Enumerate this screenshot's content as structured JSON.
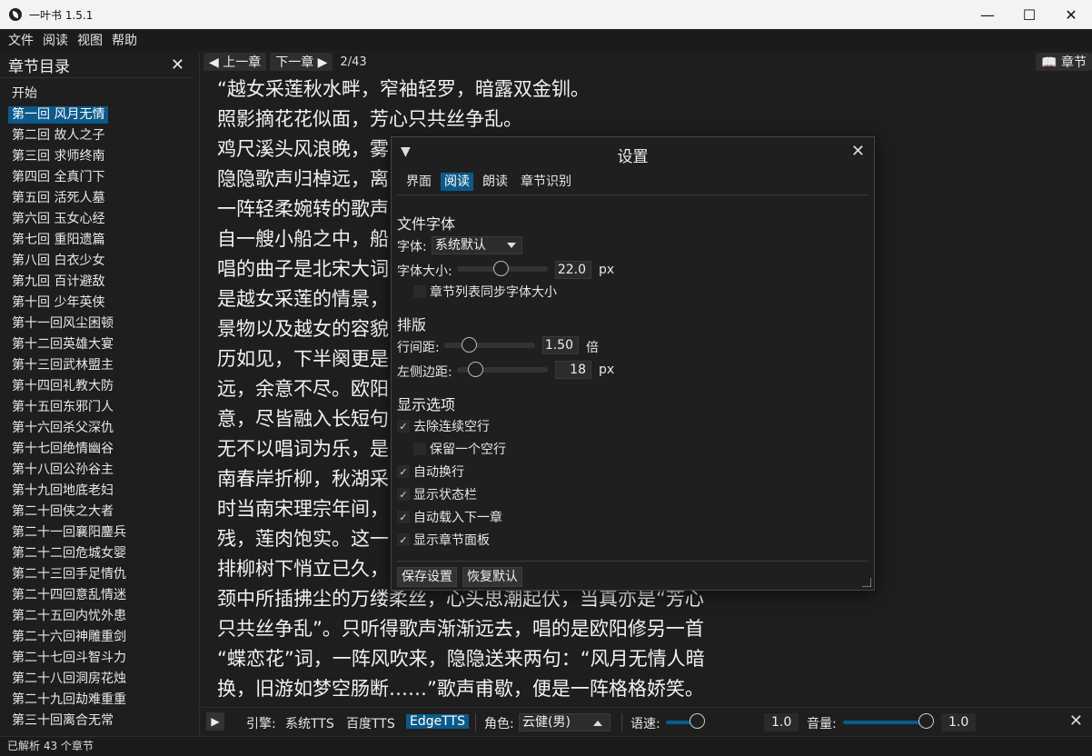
{
  "window": {
    "title": "一叶书 1.5.1",
    "min": "—",
    "max": "☐",
    "close": "✕"
  },
  "menu": [
    "文件",
    "阅读",
    "视图",
    "帮助"
  ],
  "sidebar": {
    "title": "章节目录",
    "close": "✕",
    "chapters": [
      "开始",
      "第一回 风月无情",
      "第二回 故人之子",
      "第三回 求师终南",
      "第四回 全真门下",
      "第五回 活死人墓",
      "第六回 玉女心经",
      "第七回 重阳遗篇",
      "第八回 白衣少女",
      "第九回 百计避敌",
      "第十回 少年英侠",
      "第十一回风尘困顿",
      "第十二回英雄大宴",
      "第十三回武林盟主",
      "第十四回礼教大防",
      "第十五回东邪门人",
      "第十六回杀父深仇",
      "第十七回绝情幽谷",
      "第十八回公孙谷主",
      "第十九回地底老妇",
      "第二十回侠之大者",
      "第二十一回襄阳鏖兵",
      "第二十二回危城女婴",
      "第二十三回手足情仇",
      "第二十四回意乱情迷",
      "第二十五回内忧外患",
      "第二十六回神雕重剑",
      "第二十七回斗智斗力",
      "第二十八回洞房花烛",
      "第二十九回劫难重重",
      "第三十回离合无常"
    ],
    "active_index": 1
  },
  "toolbar": {
    "prev": "◀ 上一章",
    "next": "下一章 ▶",
    "page": "2/43",
    "toc": "📖 章节"
  },
  "reader_lines": [
    "“越女采莲秋水畔，窄袖轻罗，暗露双金钏。",
    "照影摘花花似面，芳心只共丝争乱。",
    "鸡尺溪头风浪晚，雾",
    "隐隐歌声归棹远，离",
    "一阵轻柔婉转的歌声",
    "自一艘小船之中，船",
    "唱的曲子是北宋大词",
    "是越女采莲的情景，",
    "景物以及越女的容貌",
    "历如见，下半阕更是",
    "远，余意不尽。欧阳",
    "意，尽皆融入长短句",
    "无不以唱词为乐，是",
    "南春岸折柳，秋湖采",
    "时当南宋理宗年间，",
    "残，莲肉饱实。这一",
    "排柳树下悄立已久，",
    "颈中所插拂尘的万缕柔丝，心头思潮起伏，当真亦是“芳心",
    "只共丝争乱”。只听得歌声渐渐远去，唱的是欧阳修另一首",
    "“蝶恋花”词，一阵风吹来，隐隐送来两句：“风月无情人暗",
    "换，旧游如梦空肠断……”歌声甫歇，便是一阵格格娇笑。"
  ],
  "settings": {
    "arrow": "▼",
    "title": "设置",
    "close": "✕",
    "tabs": [
      "界面",
      "阅读",
      "朗读",
      "章节识别"
    ],
    "active_tab": 1,
    "file_font_section": "文件字体",
    "font_label": "字体:",
    "font_value": "系统默认",
    "font_size_label": "字体大小:",
    "font_size_value": "22.0",
    "font_size_unit": "px",
    "font_size_fraction": 0.48,
    "sync_chapter_font": "章节列表同步字体大小",
    "sync_chapter_font_checked": false,
    "layout_section": "排版",
    "line_spacing_label": "行间距:",
    "line_spacing_value": "1.50",
    "line_spacing_unit": "倍",
    "line_spacing_fraction": 0.27,
    "left_margin_label": "左侧边距:",
    "left_margin_value": "18",
    "left_margin_unit": "px",
    "left_margin_fraction": 0.2,
    "display_section": "显示选项",
    "options": [
      {
        "label": "去除连续空行",
        "checked": true
      },
      {
        "label": "保留一个空行",
        "checked": false
      },
      {
        "label": "自动换行",
        "checked": true
      },
      {
        "label": "显示状态栏",
        "checked": true
      },
      {
        "label": "自动载入下一章",
        "checked": true
      },
      {
        "label": "显示章节面板",
        "checked": true
      }
    ],
    "save_button": "保存设置",
    "reset_button": "恢复默认"
  },
  "tts": {
    "play": "▶",
    "engine_label": "引擎:",
    "engines": [
      "系统TTS",
      "百度TTS",
      "EdgeTTS"
    ],
    "active_engine": 2,
    "role_label": "角色:",
    "role_value": "云健(男)",
    "speed_label": "语速:",
    "speed_value": "1.0",
    "volume_label": "音量:",
    "volume_value": "1.0",
    "close": "✕"
  },
  "status": "已解析 43 个章节",
  "colors": {
    "accent": "#0b5a8a",
    "background": "#1e1e1e",
    "titlebar": "#f3f3f3"
  }
}
